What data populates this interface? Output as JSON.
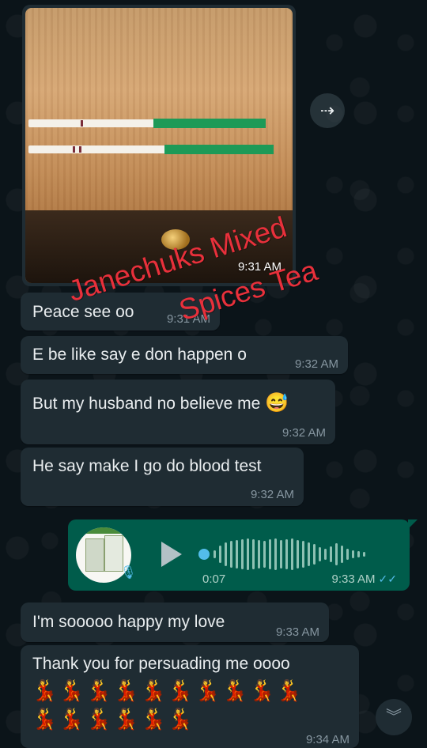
{
  "messages": {
    "image_time": "9:31 AM",
    "m1": {
      "text": "Peace see oo",
      "time": "9:31 AM"
    },
    "m2": {
      "text": "E be like say e don happen o",
      "time": "9:32 AM"
    },
    "m3": {
      "text": "But my husband no believe me",
      "emoji": "😅",
      "time": "9:32 AM"
    },
    "m4": {
      "text": "He say make I go do blood test",
      "time": "9:32 AM"
    },
    "voice": {
      "duration": "0:07",
      "time": "9:33 AM",
      "ticks": "✓✓"
    },
    "m5": {
      "text": "I'm sooooo happy my love",
      "time": "9:33 AM"
    },
    "m6": {
      "text": "Thank you for persuading me oooo",
      "emoji_row1": "💃💃💃💃💃💃💃💃💃💃",
      "emoji_row2": "💃💃💃💃💃💃",
      "time": "9:34 AM"
    }
  },
  "watermark": {
    "line1": "Janechuks Mixed",
    "line2": "Spices Tea"
  },
  "icons": {
    "forward": "forward-icon",
    "play": "play-icon",
    "mic": "microphone-icon",
    "scroll_down": "chevron-double-down-icon"
  },
  "colors": {
    "background": "#0b1419",
    "incoming_bubble": "#1f2c33",
    "outgoing_bubble": "#005c4b",
    "watermark": "#e8303b",
    "read_ticks": "#53bdeb"
  }
}
